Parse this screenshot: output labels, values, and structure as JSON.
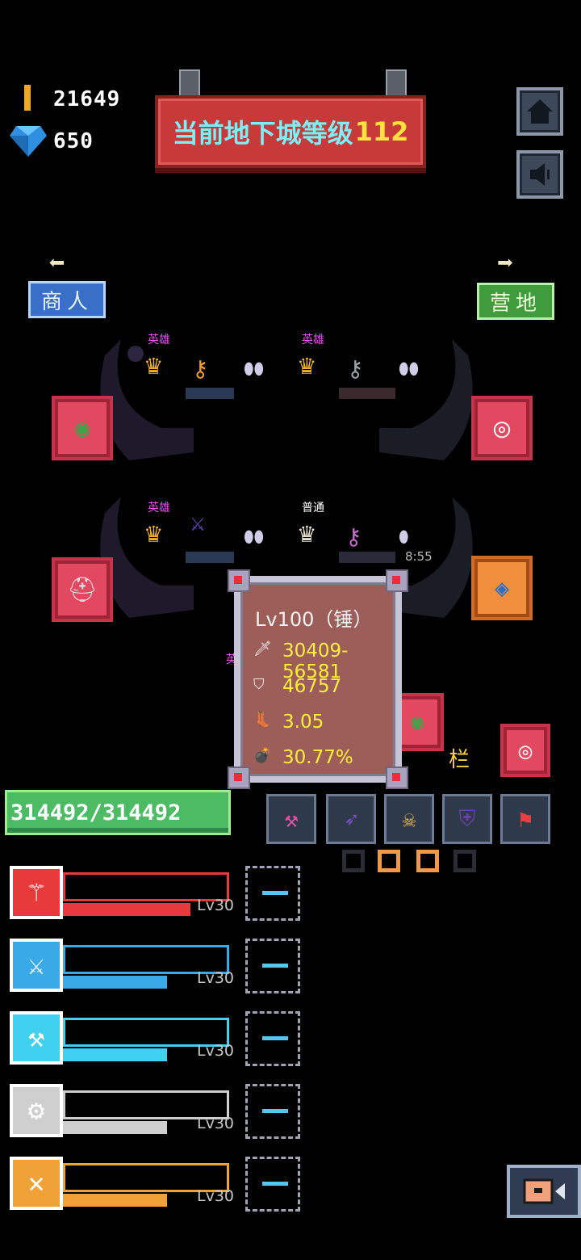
{
  "resources": {
    "gold": "21649",
    "gems": "650"
  },
  "banner": {
    "text": "当前地下城等级",
    "level": "112"
  },
  "nav": {
    "merchant": "商人",
    "camp": "营地"
  },
  "altars": {
    "labels": [
      "英雄",
      "英雄",
      "英雄",
      "普通",
      "英"
    ],
    "timer": "8:55"
  },
  "tooltip": {
    "title": "Lv100（锤）",
    "attack": "30409-56581",
    "defense": "46757",
    "speed": "3.05",
    "crit": "30.77%"
  },
  "hp": {
    "text": "314492/314492"
  },
  "slot_label": "栏",
  "skills": [
    {
      "level": "Lv30",
      "color": "#e83a3a",
      "fill": 0.95,
      "icon": "staff-icon"
    },
    {
      "level": "Lv30",
      "color": "#3aa9e8",
      "fill": 0.78,
      "icon": "crossed-weapons-icon"
    },
    {
      "level": "Lv30",
      "color": "#3fd1ef",
      "fill": 0.78,
      "icon": "hammer-icon"
    },
    {
      "level": "Lv30",
      "color": "#cfcfcf",
      "fill": 0.78,
      "icon": "gear-weapon-icon"
    },
    {
      "level": "Lv30",
      "color": "#f0a238",
      "fill": 0.78,
      "icon": "swords-icon"
    }
  ]
}
